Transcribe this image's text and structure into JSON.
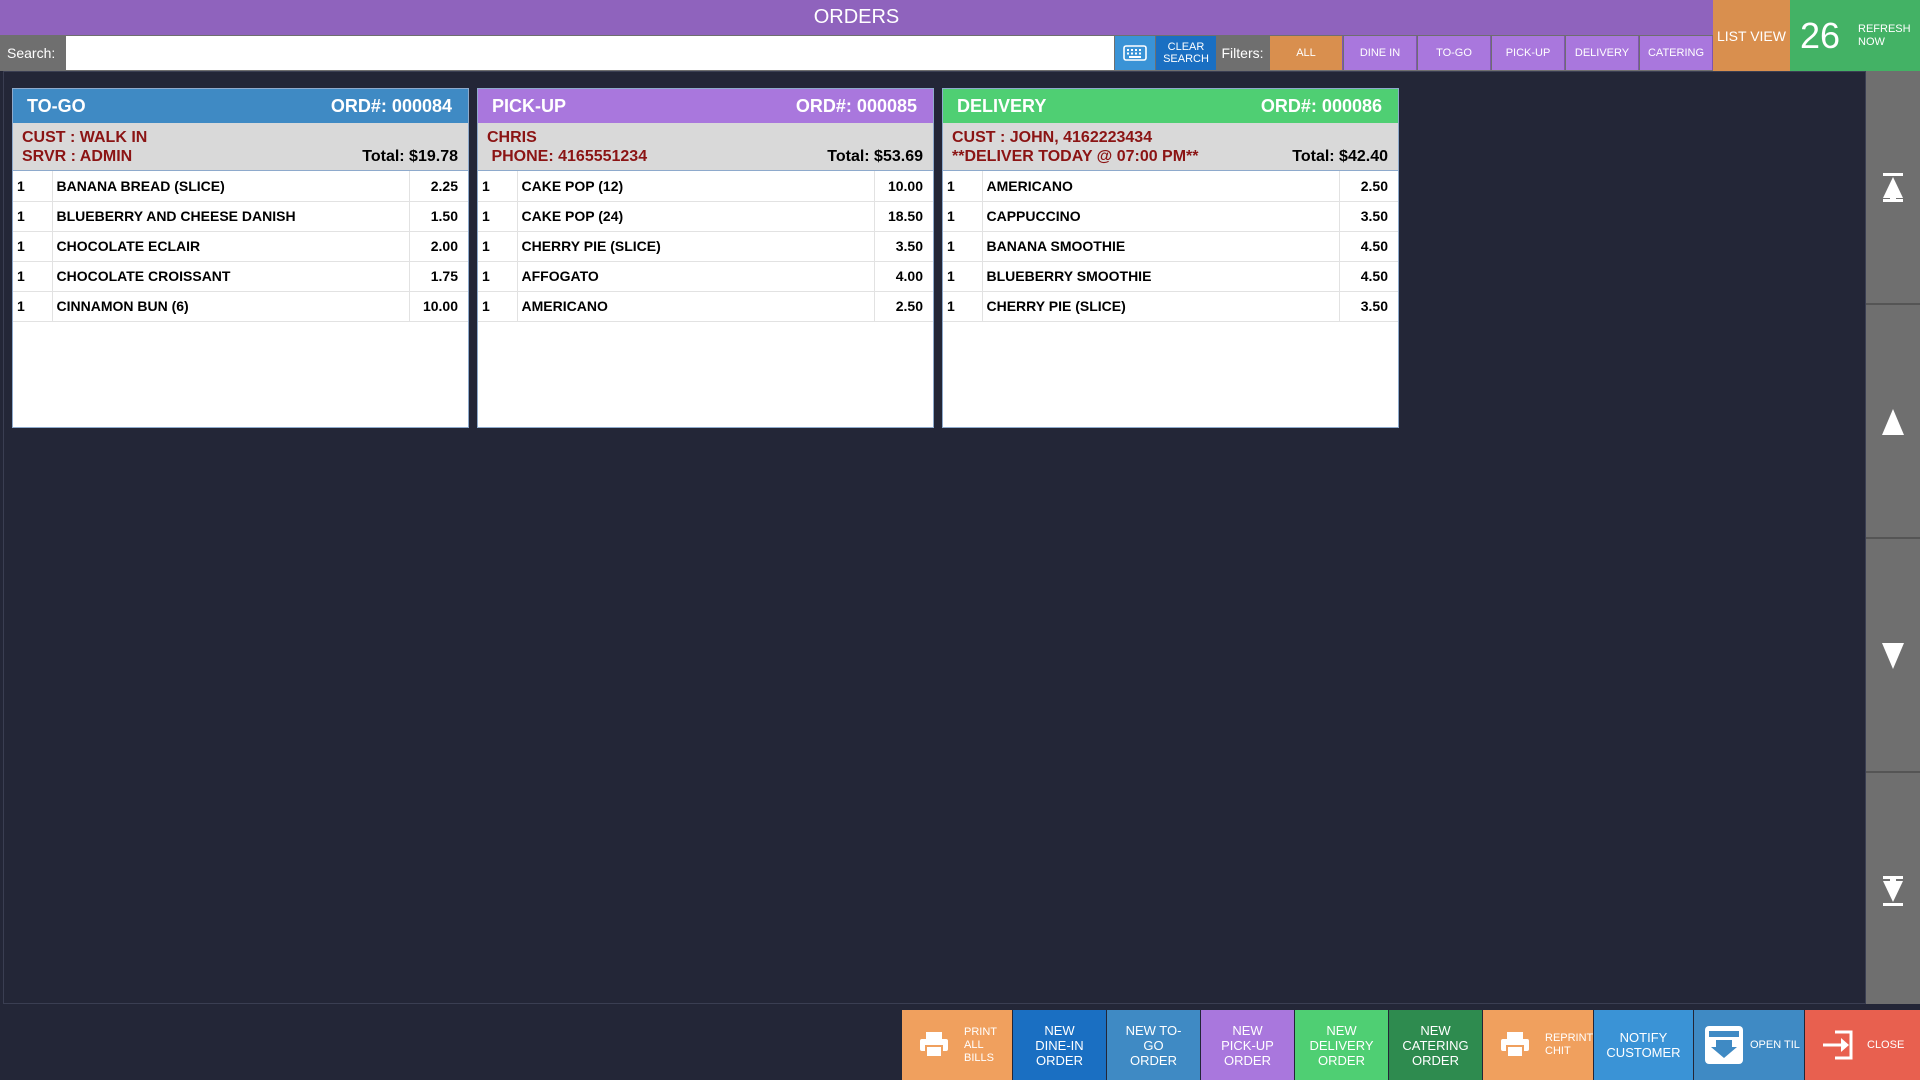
{
  "header": {
    "title": "ORDERS",
    "list_view": "LIST VIEW",
    "refresh_count": "26",
    "refresh_label": "REFRESH NOW"
  },
  "search": {
    "label": "Search:",
    "value": "",
    "clear_label": "CLEAR SEARCH"
  },
  "filters": {
    "label": "Filters:",
    "items": [
      {
        "label": "ALL",
        "active": true
      },
      {
        "label": "DINE IN"
      },
      {
        "label": "TO-GO"
      },
      {
        "label": "PICK-UP"
      },
      {
        "label": "DELIVERY"
      },
      {
        "label": "CATERING"
      }
    ]
  },
  "orders": [
    {
      "type": "TO-GO",
      "color": "#3f8ac4",
      "number": "ORD#: 000084",
      "line1": "CUST : WALK IN",
      "line2": "SRVR : ADMIN",
      "total": "Total: $19.78",
      "items": [
        {
          "qty": "1",
          "name": "BANANA BREAD (SLICE)",
          "price": "2.25"
        },
        {
          "qty": "1",
          "name": "BLUEBERRY AND CHEESE DANISH",
          "price": "1.50"
        },
        {
          "qty": "1",
          "name": "CHOCOLATE ECLAIR",
          "price": "2.00"
        },
        {
          "qty": "1",
          "name": "CHOCOLATE CROISSANT",
          "price": "1.75"
        },
        {
          "qty": "1",
          "name": "CINNAMON BUN (6)",
          "price": "10.00"
        }
      ]
    },
    {
      "type": "PICK-UP",
      "color": "#a977dd",
      "number": "ORD#: 000085",
      "line1": "CHRIS",
      "line2": " PHONE: 4165551234",
      "total": "Total: $53.69",
      "items": [
        {
          "qty": "1",
          "name": "CAKE POP (12)",
          "price": "10.00"
        },
        {
          "qty": "1",
          "name": "CAKE POP (24)",
          "price": "18.50"
        },
        {
          "qty": "1",
          "name": "CHERRY PIE (SLICE)",
          "price": "3.50"
        },
        {
          "qty": "1",
          "name": "AFFOGATO",
          "price": "4.00"
        },
        {
          "qty": "1",
          "name": "AMERICANO",
          "price": "2.50"
        }
      ]
    },
    {
      "type": "DELIVERY",
      "color": "#4fcf73",
      "number": "ORD#: 000086",
      "line1": "CUST : JOHN, 4162223434",
      "line2": "**DELIVER TODAY @ 07:00 PM**",
      "total": "Total: $42.40",
      "items": [
        {
          "qty": "1",
          "name": "AMERICANO",
          "price": "2.50"
        },
        {
          "qty": "1",
          "name": "CAPPUCCINO",
          "price": "3.50"
        },
        {
          "qty": "1",
          "name": "BANANA SMOOTHIE",
          "price": "4.50"
        },
        {
          "qty": "1",
          "name": "BLUEBERRY SMOOTHIE",
          "price": "4.50"
        },
        {
          "qty": "1",
          "name": "CHERRY PIE (SLICE)",
          "price": "3.50"
        }
      ]
    }
  ],
  "actions": {
    "print_all": "PRINT ALL BILLS",
    "new_dine_in": "NEW DINE-IN ORDER",
    "new_to_go": "NEW TO-GO ORDER",
    "new_pick_up": "NEW PICK-UP ORDER",
    "new_delivery": "NEW DELIVERY ORDER",
    "new_catering": "NEW CATERING ORDER",
    "reprint_chit": "REPRINT CHIT",
    "notify_customer": "NOTIFY CUSTOMER",
    "open_til": "OPEN TIL",
    "close": "CLOSE"
  },
  "colors": {
    "purple": "#8f63bd",
    "orange": "#d98f4e",
    "green": "#43b265",
    "blue": "#1a6fc2",
    "red": "#e8604f"
  }
}
